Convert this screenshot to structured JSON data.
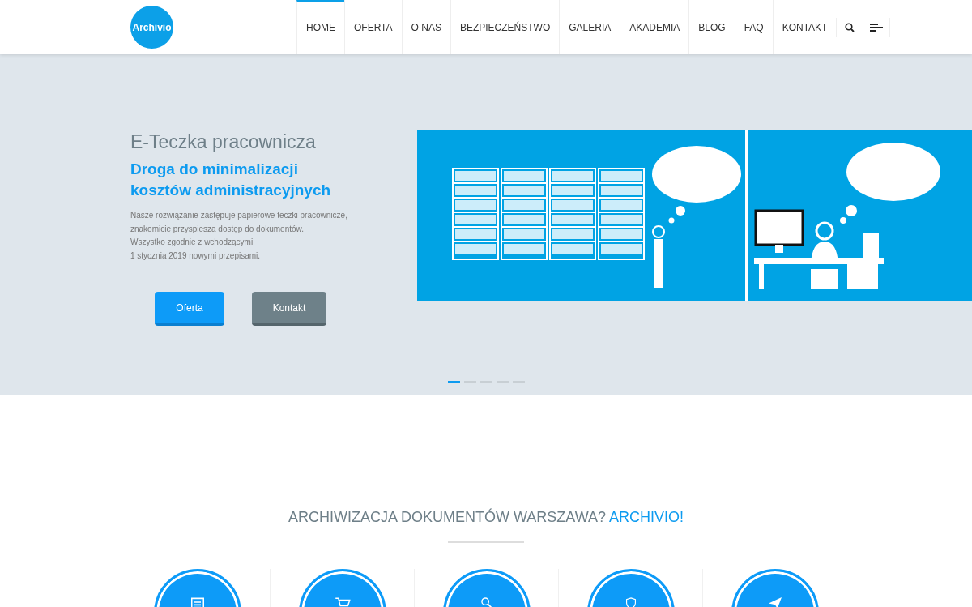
{
  "header": {
    "logo": "Archivio",
    "nav": [
      {
        "label": "HOME",
        "selected": true
      },
      {
        "label": "OFERTA",
        "selected": false
      },
      {
        "label": "O NAS",
        "selected": false
      },
      {
        "label": "BEZPIECZEŃSTWO",
        "selected": false
      },
      {
        "label": "GALERIA",
        "selected": false
      },
      {
        "label": "AKADEMIA",
        "selected": false
      },
      {
        "label": "BLOG",
        "selected": false
      },
      {
        "label": "FAQ",
        "selected": false
      },
      {
        "label": "KONTAKT",
        "selected": false
      }
    ]
  },
  "hero": {
    "title": "E-Teczka pracownicza",
    "subtitle": "Droga do minimalizacji kosztów administracyjnych",
    "text_lines": [
      "Nasze rozwiązanie zastępuje papierowe teczki pracownicze,",
      "znakomicie przyspiesza dostęp do dokumentów.",
      "Wszystko zgodnie z wchodzącymi",
      "1 stycznia 2019 nowymi przepisami."
    ],
    "buttons": [
      {
        "label": "Oferta",
        "kind": "primary"
      },
      {
        "label": "Kontakt",
        "kind": "secondary"
      }
    ],
    "slides": [
      {
        "selected": true
      },
      {
        "selected": false
      },
      {
        "selected": false
      },
      {
        "selected": false
      },
      {
        "selected": false
      }
    ]
  },
  "section": {
    "heading": "ARCHIWIZACJA DOKUMENTÓW WARSZAWA?",
    "heading_accent": "ARCHIVIO!",
    "features": [
      {
        "kind": "document"
      },
      {
        "kind": "cart"
      },
      {
        "kind": "search"
      },
      {
        "kind": "shield"
      },
      {
        "kind": "plane"
      }
    ]
  }
}
